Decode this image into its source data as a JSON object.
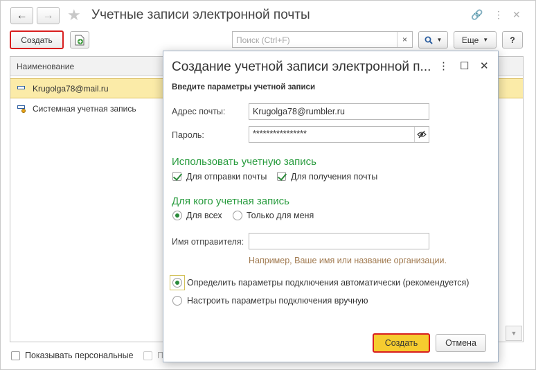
{
  "window": {
    "title": "Учетные записи электронной почты",
    "back_icon": "←",
    "forward_icon": "→",
    "star_icon": "★",
    "link_icon": "🔗",
    "more_icon": "⋮",
    "close_icon": "✕"
  },
  "toolbar": {
    "create_label": "Создать",
    "search_placeholder": "Поиск (Ctrl+F)",
    "search_clear": "×",
    "search_icon": "🔍",
    "more_label": "Еще",
    "help_label": "?"
  },
  "list": {
    "column_header": "Наименование",
    "rows": [
      {
        "label": "Krugolga78@mail.ru",
        "selected": true
      },
      {
        "label": "Системная учетная запись",
        "selected": false
      }
    ]
  },
  "footer": {
    "show_personal_label": "Показывать персональные",
    "second_checkbox_label": "П"
  },
  "dialog": {
    "title": "Создание учетной записи электронной п...",
    "more_icon": "⋮",
    "maximize_icon": "☐",
    "close_icon": "✕",
    "subtitle": "Введите параметры учетной записи",
    "email_label": "Адрес почты:",
    "email_value": "Krugolga78@rumbler.ru",
    "password_label": "Пароль:",
    "password_value": "****************",
    "use_section": "Использовать учетную запись",
    "for_sending_label": "Для отправки почты",
    "for_receiving_label": "Для получения почты",
    "for_whom_section": "Для кого учетная запись",
    "for_all_label": "Для всех",
    "only_me_label": "Только для меня",
    "sender_name_label": "Имя отправителя:",
    "sender_name_value": "",
    "sender_hint": "Например, Ваше имя или название организации.",
    "auto_params_label": "Определить параметры подключения автоматически (рекомендуется)",
    "manual_params_label": "Настроить параметры подключения вручную",
    "create_button": "Создать",
    "cancel_button": "Отмена"
  },
  "colors": {
    "accent_green": "#279b3d",
    "highlight_red": "#d81e1e",
    "primary_yellow": "#f6cc2f",
    "selection_bg": "#fbeba8"
  }
}
